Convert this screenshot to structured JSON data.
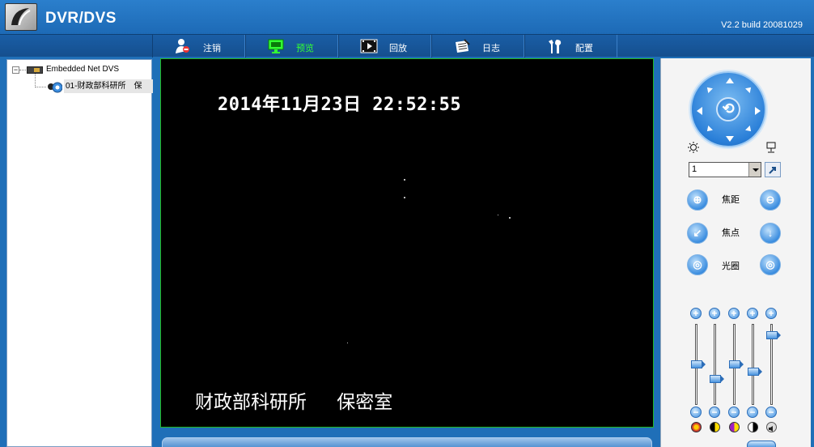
{
  "app": {
    "title": "DVR/DVS",
    "version": "V2.2  build 20081029"
  },
  "nav": {
    "items": [
      {
        "label": "注销",
        "icon": "user-logout-icon",
        "active": false
      },
      {
        "label": "预览",
        "icon": "monitor-preview-icon",
        "active": true
      },
      {
        "label": "回放",
        "icon": "film-playback-icon",
        "active": false
      },
      {
        "label": "日志",
        "icon": "log-notepad-icon",
        "active": false
      },
      {
        "label": "配置",
        "icon": "tools-config-icon",
        "active": false
      }
    ]
  },
  "tree": {
    "root_label": "Embedded Net DVS",
    "root_expander": "−",
    "channel_label": "01-财政部科研所　保"
  },
  "video": {
    "timestamp": "2014年11月23日  22:52:55",
    "caption": "财政部科研所 保密室"
  },
  "ptz": {
    "preset_value": "1",
    "zoom_label": "焦距",
    "focus_label": "焦点",
    "iris_label": "光圈",
    "colors": {
      "accent": "#2a7fd8",
      "active_nav": "#33ff33",
      "video_border": "#22b822"
    }
  },
  "image_adjust": {
    "sliders": [
      {
        "name": "brightness",
        "icon": "brightness-icon",
        "level": 0.5
      },
      {
        "name": "contrast",
        "icon": "contrast-icon",
        "level": 0.3
      },
      {
        "name": "saturation",
        "icon": "saturation-icon",
        "level": 0.5
      },
      {
        "name": "hue",
        "icon": "hue-icon",
        "level": 0.4
      },
      {
        "name": "volume",
        "icon": "volume-icon",
        "level": 0.9
      }
    ]
  }
}
